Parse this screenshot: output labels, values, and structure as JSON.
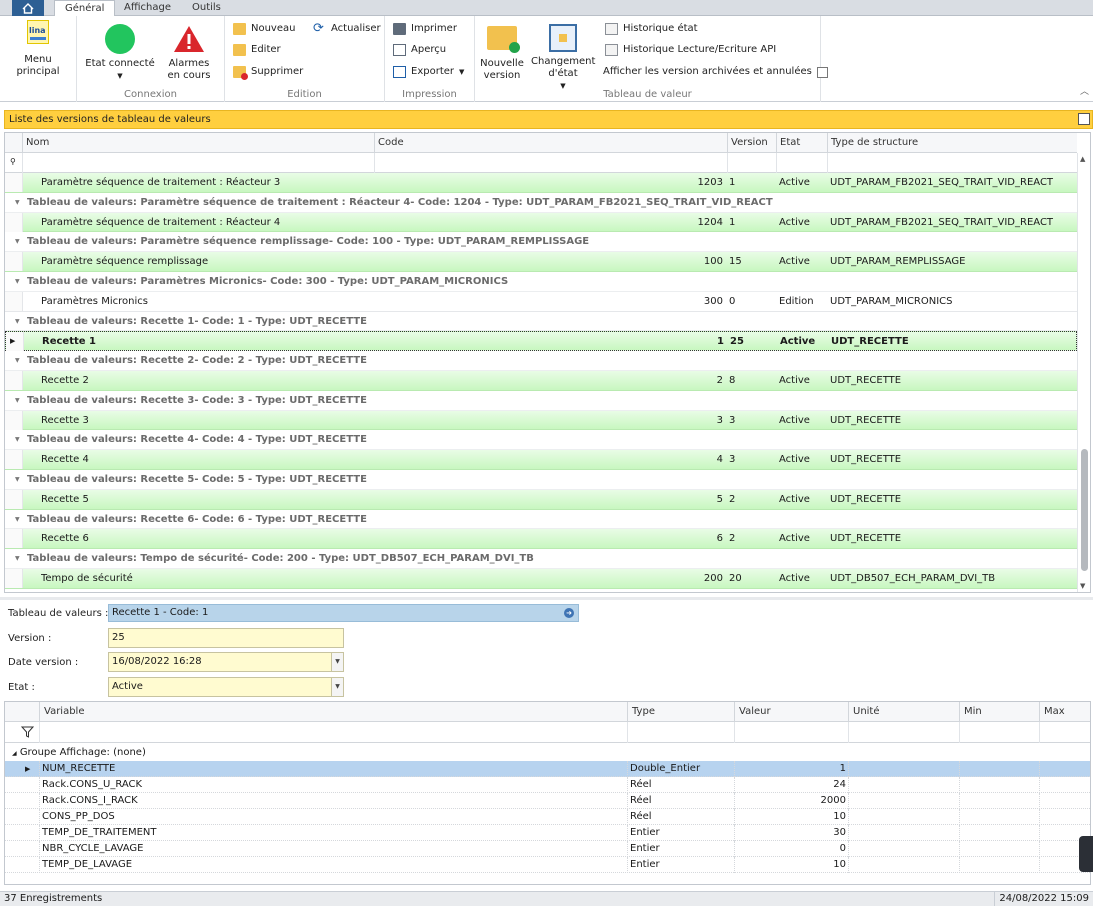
{
  "tabs": {
    "general": "Général",
    "affichage": "Affichage",
    "outils": "Outils"
  },
  "ribbon": {
    "menu_principal": "Menu principal",
    "logo_text": "lina",
    "etat_connecte": "Etat connecté",
    "alarmes": "Alarmes\nen cours",
    "connexion_label": "Connexion",
    "nouveau": "Nouveau",
    "actualiser": "Actualiser",
    "editer": "Editer",
    "supprimer": "Supprimer",
    "edition_label": "Edition",
    "imprimer": "Imprimer",
    "apercu": "Aperçu",
    "exporter": "Exporter",
    "impression_label": "Impression",
    "nouvelle_version": "Nouvelle\nversion",
    "changement_etat": "Changement\nd'état",
    "historique_etat": "Historique état",
    "historique_api": "Historique Lecture/Ecriture API",
    "afficher_archivees": "Afficher les version archivées et annulées",
    "tableau_label": "Tableau de valeur"
  },
  "list": {
    "title": "Liste des versions de tableau de valeurs",
    "columns": {
      "nom": "Nom",
      "code": "Code",
      "version": "Version",
      "etat": "Etat",
      "type": "Type de structure"
    },
    "rows": [
      {
        "kind": "data",
        "nom": "Paramètre séquence de traitement : Réacteur 3",
        "code": "1203",
        "version": "1",
        "etat": "Active",
        "type": "UDT_PARAM_FB2021_SEQ_TRAIT_VID_REACT"
      },
      {
        "kind": "group",
        "text": "Tableau de valeurs: Paramètre séquence de traitement : Réacteur 4- Code: 1204 - Type: UDT_PARAM_FB2021_SEQ_TRAIT_VID_REACT"
      },
      {
        "kind": "data",
        "nom": "Paramètre séquence de traitement : Réacteur 4",
        "code": "1204",
        "version": "1",
        "etat": "Active",
        "type": "UDT_PARAM_FB2021_SEQ_TRAIT_VID_REACT"
      },
      {
        "kind": "group",
        "text": "Tableau de valeurs: Paramètre séquence remplissage- Code: 100 - Type: UDT_PARAM_REMPLISSAGE"
      },
      {
        "kind": "data",
        "nom": "Paramètre séquence remplissage",
        "code": "100",
        "version": "15",
        "etat": "Active",
        "type": "UDT_PARAM_REMPLISSAGE"
      },
      {
        "kind": "group",
        "text": "Tableau de valeurs: Paramètres Micronics- Code: 300 - Type: UDT_PARAM_MICRONICS"
      },
      {
        "kind": "plain",
        "nom": "Paramètres Micronics",
        "code": "300",
        "version": "0",
        "etat": "Edition",
        "type": "UDT_PARAM_MICRONICS"
      },
      {
        "kind": "group",
        "text": "Tableau de valeurs: Recette 1- Code: 1 - Type: UDT_RECETTE"
      },
      {
        "kind": "selected",
        "nom": "Recette 1",
        "code": "1",
        "version": "25",
        "etat": "Active",
        "type": "UDT_RECETTE"
      },
      {
        "kind": "group",
        "text": "Tableau de valeurs: Recette 2- Code: 2 - Type: UDT_RECETTE"
      },
      {
        "kind": "data",
        "nom": "Recette 2",
        "code": "2",
        "version": "8",
        "etat": "Active",
        "type": "UDT_RECETTE"
      },
      {
        "kind": "group",
        "text": "Tableau de valeurs: Recette 3- Code: 3 - Type: UDT_RECETTE"
      },
      {
        "kind": "data",
        "nom": "Recette 3",
        "code": "3",
        "version": "3",
        "etat": "Active",
        "type": "UDT_RECETTE"
      },
      {
        "kind": "group",
        "text": "Tableau de valeurs: Recette 4- Code: 4 - Type: UDT_RECETTE"
      },
      {
        "kind": "data",
        "nom": "Recette 4",
        "code": "4",
        "version": "3",
        "etat": "Active",
        "type": "UDT_RECETTE"
      },
      {
        "kind": "group",
        "text": "Tableau de valeurs: Recette 5- Code: 5 - Type: UDT_RECETTE"
      },
      {
        "kind": "data",
        "nom": "Recette 5",
        "code": "5",
        "version": "2",
        "etat": "Active",
        "type": "UDT_RECETTE"
      },
      {
        "kind": "group",
        "text": "Tableau de valeurs: Recette 6- Code: 6 - Type: UDT_RECETTE"
      },
      {
        "kind": "data",
        "nom": "Recette 6",
        "code": "6",
        "version": "2",
        "etat": "Active",
        "type": "UDT_RECETTE"
      },
      {
        "kind": "group",
        "text": "Tableau de valeurs: Tempo de sécurité- Code: 200 - Type: UDT_DB507_ECH_PARAM_DVI_TB"
      },
      {
        "kind": "data",
        "nom": "Tempo de sécurité",
        "code": "200",
        "version": "20",
        "etat": "Active",
        "type": "UDT_DB507_ECH_PARAM_DVI_TB"
      }
    ]
  },
  "detail": {
    "tableau_label": "Tableau de valeurs :",
    "tableau_value": "Recette 1 - Code: 1",
    "version_label": "Version :",
    "version_value": "25",
    "date_label": "Date version :",
    "date_value": "16/08/2022  16:28",
    "etat_label": "Etat :",
    "etat_value": "Active"
  },
  "variables": {
    "columns": {
      "variable": "Variable",
      "type": "Type",
      "valeur": "Valeur",
      "unite": "Unité",
      "min": "Min",
      "max": "Max"
    },
    "group": "Groupe Affichage:  (none)",
    "rows": [
      {
        "variable": "NUM_RECETTE",
        "type": "Double_Entier",
        "valeur": "1"
      },
      {
        "variable": "Rack.CONS_U_RACK",
        "type": "Réel",
        "valeur": "24"
      },
      {
        "variable": "Rack.CONS_I_RACK",
        "type": "Réel",
        "valeur": "2000"
      },
      {
        "variable": "CONS_PP_DOS",
        "type": "Réel",
        "valeur": "10"
      },
      {
        "variable": "TEMP_DE_TRAITEMENT",
        "type": "Entier",
        "valeur": "30"
      },
      {
        "variable": "NBR_CYCLE_LAVAGE",
        "type": "Entier",
        "valeur": "0"
      },
      {
        "variable": "TEMP_DE_LAVAGE",
        "type": "Entier",
        "valeur": "10"
      }
    ]
  },
  "status": {
    "count": "37 Enregistrements",
    "datetime": "24/08/2022 15:09"
  },
  "colors": {
    "accent_yellow": "#ffcf3f",
    "row_green": "#c8f7c0",
    "selection_blue": "#b7d3ef",
    "connected_green": "#22c55e",
    "alarm_red": "#d9262c"
  }
}
